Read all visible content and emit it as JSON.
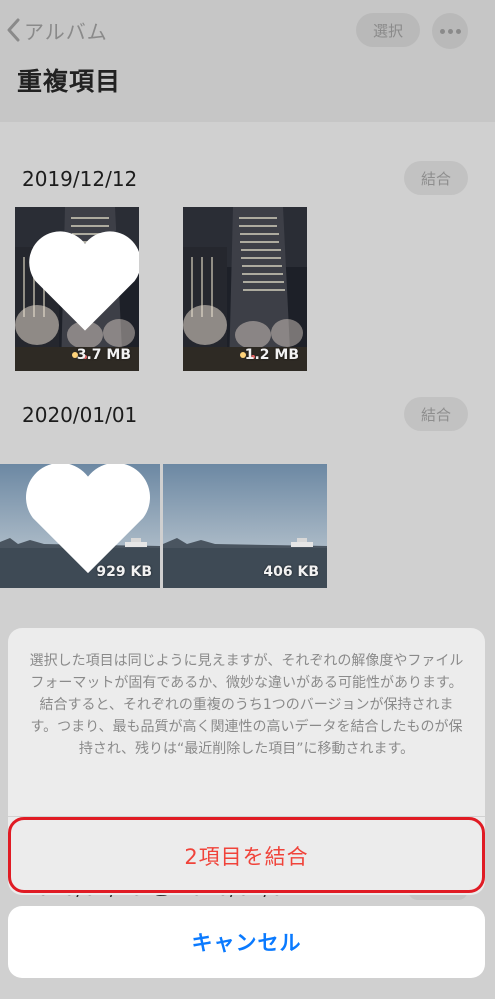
{
  "nav": {
    "back_label": "アルバム",
    "select_label": "選択",
    "title": "重複項目"
  },
  "groups": [
    {
      "date": "2019/12/12",
      "merge_label": "結合",
      "items": [
        {
          "size": "3.7 MB",
          "favorite": true,
          "scene": "night-city-icon"
        },
        {
          "size": "1.2 MB",
          "favorite": false,
          "scene": "night-city-icon"
        }
      ]
    },
    {
      "date": "2020/01/01",
      "merge_label": "結合",
      "items": [
        {
          "size": "929 KB",
          "favorite": true,
          "scene": "bay-landscape-icon"
        },
        {
          "size": "406 KB",
          "favorite": false,
          "scene": "bay-landscape-icon"
        }
      ]
    }
  ],
  "hidden_group_date": "2020/01/16 と 2020/02/04",
  "action_sheet": {
    "message": "選択した項目は同じように見えますが、それぞれの解像度やファイルフォーマットが固有であるか、微妙な違いがある可能性があります。結合すると、それぞれの重複のうち1つのバージョンが保持されます。つまり、最も品質が高く関連性の高いデータを結合したものが保持され、残りは“最近削除した項目”に移動されます。",
    "merge_action": "2項目を結合",
    "cancel": "キャンセル"
  },
  "colors": {
    "destructive": "#f0433a",
    "tint": "#0a7aff",
    "highlight_box": "#e01b24"
  }
}
